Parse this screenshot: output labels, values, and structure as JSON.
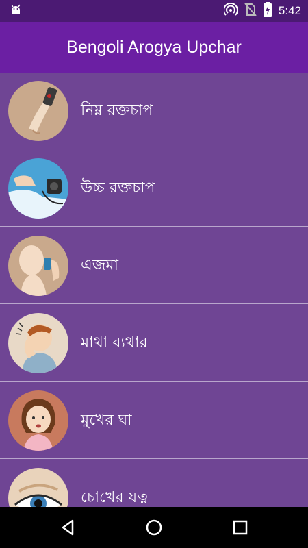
{
  "status_bar": {
    "time": "5:42"
  },
  "app_bar": {
    "title": "Bengoli Arogya Upchar"
  },
  "list": {
    "items": [
      {
        "label": "নিম্ন রক্তচাপ",
        "icon": "arm-blood-pressure-image"
      },
      {
        "label": "উচ্চ রক্তচাপ",
        "icon": "bp-monitor-image"
      },
      {
        "label": "এজমা",
        "icon": "asthma-inhaler-image"
      },
      {
        "label": "মাথা ব্যথার",
        "icon": "headache-man-image"
      },
      {
        "label": "মুখের ঘা",
        "icon": "mouth-ulcer-girl-image"
      },
      {
        "label": "চোখের যত্ন",
        "icon": "eye-care-image"
      }
    ]
  },
  "colors": {
    "status_bar": "#4b1a73",
    "app_bar": "#6b1fa3",
    "list_background": "#6f4594",
    "divider": "#b9a6cc"
  }
}
